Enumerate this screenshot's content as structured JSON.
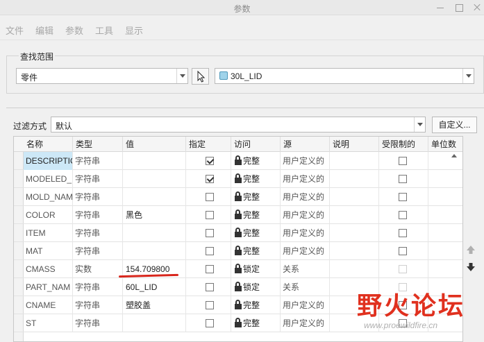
{
  "window": {
    "title": "参数"
  },
  "menu": [
    "文件",
    "编辑",
    "参数",
    "工具",
    "显示"
  ],
  "search": {
    "group_label": "查找范围",
    "scope_value": "零件",
    "model_value": "30L_LID"
  },
  "filter": {
    "label": "过滤方式",
    "value": "默认",
    "custom_button": "自定义..."
  },
  "table": {
    "columns": [
      "名称",
      "类型",
      "值",
      "指定",
      "访问",
      "源",
      "说明",
      "受限制的",
      "单位数"
    ],
    "rows": [
      {
        "name": "DESCRIPTIO",
        "type": "字符串",
        "value": "",
        "designate": true,
        "access": "完整",
        "source": "用户定义的",
        "restricted": false,
        "selected": true
      },
      {
        "name": "MODELED_",
        "type": "字符串",
        "value": "",
        "designate": true,
        "access": "完整",
        "source": "用户定义的",
        "restricted": false
      },
      {
        "name": "MOLD_NAM",
        "type": "字符串",
        "value": "",
        "designate": false,
        "access": "完整",
        "source": "用户定义的",
        "restricted": false
      },
      {
        "name": "COLOR",
        "type": "字符串",
        "value": "黑色",
        "designate": false,
        "access": "完整",
        "source": "用户定义的",
        "restricted": false
      },
      {
        "name": "ITEM",
        "type": "字符串",
        "value": "",
        "designate": false,
        "access": "完整",
        "source": "用户定义的",
        "restricted": false
      },
      {
        "name": "MAT",
        "type": "字符串",
        "value": "",
        "designate": false,
        "access": "完整",
        "source": "用户定义的",
        "restricted": false
      },
      {
        "name": "CMASS",
        "type": "实数",
        "value": "154.709800",
        "designate": false,
        "access": "锁定",
        "source": "关系",
        "restricted": false,
        "restricted_disabled": true
      },
      {
        "name": "PART_NAM",
        "type": "字符串",
        "value": "60L_LID",
        "designate": false,
        "access": "锁定",
        "source": "关系",
        "restricted": false,
        "restricted_disabled": true
      },
      {
        "name": "CNAME",
        "type": "字符串",
        "value": "塑胶盖",
        "designate": false,
        "access": "完整",
        "source": "用户定义的",
        "restricted": false
      },
      {
        "name": "ST",
        "type": "字符串",
        "value": "",
        "designate": false,
        "access": "完整",
        "source": "用户定义的",
        "restricted": false
      }
    ]
  },
  "watermark": {
    "logo": "野火论坛",
    "url": "www.proewildfire.cn"
  },
  "colors": {
    "selected_cell": "#cde8f7",
    "annotation_red": "#d8261c"
  }
}
